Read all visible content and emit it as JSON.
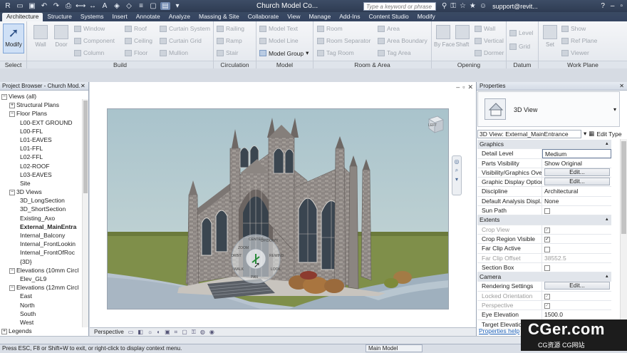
{
  "title_bar": {
    "document_title": "Church Model Co...",
    "search_placeholder": "Type a keyword or phrase",
    "user": "support@revit..."
  },
  "ribbon_tabs": [
    "Architecture",
    "Structure",
    "Systems",
    "Insert",
    "Annotate",
    "Analyze",
    "Massing & Site",
    "Collaborate",
    "View",
    "Manage",
    "Add-Ins",
    "Content Studio",
    "Modify"
  ],
  "active_tab": "Architecture",
  "ribbon": {
    "select": {
      "modify_label": "Modify",
      "panel_label": "Select"
    },
    "build": {
      "wall": "Wall",
      "door": "Door",
      "window": "Window",
      "component": "Component",
      "column": "Column",
      "roof": "Roof",
      "ceiling": "Ceiling",
      "floor": "Floor",
      "curtain_system": "Curtain System",
      "curtain_grid": "Curtain Grid",
      "mullion": "Mullion",
      "panel_label": "Build"
    },
    "circulation": {
      "railing": "Railing",
      "ramp": "Ramp",
      "stair": "Stair",
      "panel_label": "Circulation"
    },
    "model": {
      "model_text": "Model Text",
      "model_line": "Model Line",
      "model_group": "Model Group",
      "panel_label": "Model"
    },
    "room_area": {
      "room": "Room",
      "room_separator": "Room Separator",
      "tag_room": "Tag Room",
      "area": "Area",
      "area_boundary": "Area Boundary",
      "tag_area": "Tag Area",
      "panel_label": "Room & Area"
    },
    "opening": {
      "by_face": "By Face",
      "shaft": "Shaft",
      "wall": "Wall",
      "vertical": "Vertical",
      "dormer": "Dormer",
      "panel_label": "Opening"
    },
    "datum": {
      "level": "Level",
      "grid": "Grid",
      "panel_label": "Datum"
    },
    "work_plane": {
      "set": "Set",
      "show": "Show",
      "ref_plane": "Ref Plane",
      "viewer": "Viewer",
      "panel_label": "Work Plane"
    }
  },
  "project_browser": {
    "title": "Project Browser - Church Mod...",
    "items": [
      {
        "label": "Views (all)",
        "level": 0,
        "exp": "−"
      },
      {
        "label": "Structural Plans",
        "level": 1,
        "exp": "+"
      },
      {
        "label": "Floor Plans",
        "level": 1,
        "exp": "−"
      },
      {
        "label": "L00-EXT GROUND",
        "level": 2,
        "exp": ""
      },
      {
        "label": "L00-FFL",
        "level": 2,
        "exp": ""
      },
      {
        "label": "L01-EAVES",
        "level": 2,
        "exp": ""
      },
      {
        "label": "L01-FFL",
        "level": 2,
        "exp": ""
      },
      {
        "label": "L02-FFL",
        "level": 2,
        "exp": ""
      },
      {
        "label": "L02-ROOF",
        "level": 2,
        "exp": ""
      },
      {
        "label": "L03-EAVES",
        "level": 2,
        "exp": ""
      },
      {
        "label": "Site",
        "level": 2,
        "exp": ""
      },
      {
        "label": "3D Views",
        "level": 1,
        "exp": "−"
      },
      {
        "label": "3D_LongSection",
        "level": 2,
        "exp": ""
      },
      {
        "label": "3D_ShortSection",
        "level": 2,
        "exp": ""
      },
      {
        "label": "Existing_Axo",
        "level": 2,
        "exp": ""
      },
      {
        "label": "External_MainEntra",
        "level": 2,
        "exp": "",
        "bold": true
      },
      {
        "label": "Internal_Balcony",
        "level": 2,
        "exp": ""
      },
      {
        "label": "Internal_FrontLookin",
        "level": 2,
        "exp": ""
      },
      {
        "label": "Internal_FrontOfRoc",
        "level": 2,
        "exp": ""
      },
      {
        "label": "{3D}",
        "level": 2,
        "exp": ""
      },
      {
        "label": "Elevations (10mm Circl",
        "level": 1,
        "exp": "−"
      },
      {
        "label": "Elev_GL9",
        "level": 2,
        "exp": ""
      },
      {
        "label": "Elevations (12mm Circl",
        "level": 1,
        "exp": "−"
      },
      {
        "label": "East",
        "level": 2,
        "exp": ""
      },
      {
        "label": "North",
        "level": 2,
        "exp": ""
      },
      {
        "label": "South",
        "level": 2,
        "exp": ""
      },
      {
        "label": "West",
        "level": 2,
        "exp": ""
      },
      {
        "label": "Legends",
        "level": 0,
        "exp": "+"
      }
    ]
  },
  "view": {
    "viewcube_label": "LEFT",
    "view_scale": "Perspective",
    "steering_wheel_labels": [
      "ZOOM",
      "ORBIT",
      "PAN",
      "REWIND",
      "CENTER",
      "WALK",
      "LOOK",
      "UP/DOWN"
    ]
  },
  "properties": {
    "title": "Properties",
    "type_name": "3D View",
    "instance_selector": "3D View: External_MainEntrance",
    "edit_type": "Edit Type",
    "rows": [
      {
        "group": "Graphics"
      },
      {
        "k": "Detail Level",
        "v": "Medium",
        "kind": "box"
      },
      {
        "k": "Parts Visibility",
        "v": "Show Original",
        "kind": "text"
      },
      {
        "k": "Visibility/Graphics Ove...",
        "v": "Edit...",
        "kind": "button"
      },
      {
        "k": "Graphic Display Options",
        "v": "Edit...",
        "kind": "button"
      },
      {
        "k": "Discipline",
        "v": "Architectural",
        "kind": "text"
      },
      {
        "k": "Default Analysis Displ...",
        "v": "None",
        "kind": "text"
      },
      {
        "k": "Sun Path",
        "v": "",
        "kind": "check",
        "checked": false
      },
      {
        "group": "Extents"
      },
      {
        "k": "Crop View",
        "v": "",
        "kind": "check",
        "checked": true,
        "dim": true
      },
      {
        "k": "Crop Region Visible",
        "v": "",
        "kind": "check",
        "checked": true
      },
      {
        "k": "Far Clip Active",
        "v": "",
        "kind": "check",
        "checked": false
      },
      {
        "k": "Far Clip Offset",
        "v": "38552.5",
        "kind": "text",
        "dim": true
      },
      {
        "k": "Section Box",
        "v": "",
        "kind": "check",
        "checked": false
      },
      {
        "group": "Camera"
      },
      {
        "k": "Rendering Settings",
        "v": "Edit...",
        "kind": "button"
      },
      {
        "k": "Locked Orientation",
        "v": "",
        "kind": "check",
        "checked": true,
        "dim": true
      },
      {
        "k": "Perspective",
        "v": "",
        "kind": "check",
        "checked": true,
        "dim": true
      },
      {
        "k": "Eye Elevation",
        "v": "1500.0",
        "kind": "text"
      },
      {
        "k": "Target Elevation",
        "v": "",
        "kind": "text"
      }
    ],
    "help_link": "Properties help"
  },
  "status_bar": {
    "message": "Press ESC, F8 or Shift+W to exit, or right-click to display context menu.",
    "model": "Main Model"
  },
  "watermark": {
    "big": "CGer.com",
    "small": "CG资源 CG网站"
  }
}
